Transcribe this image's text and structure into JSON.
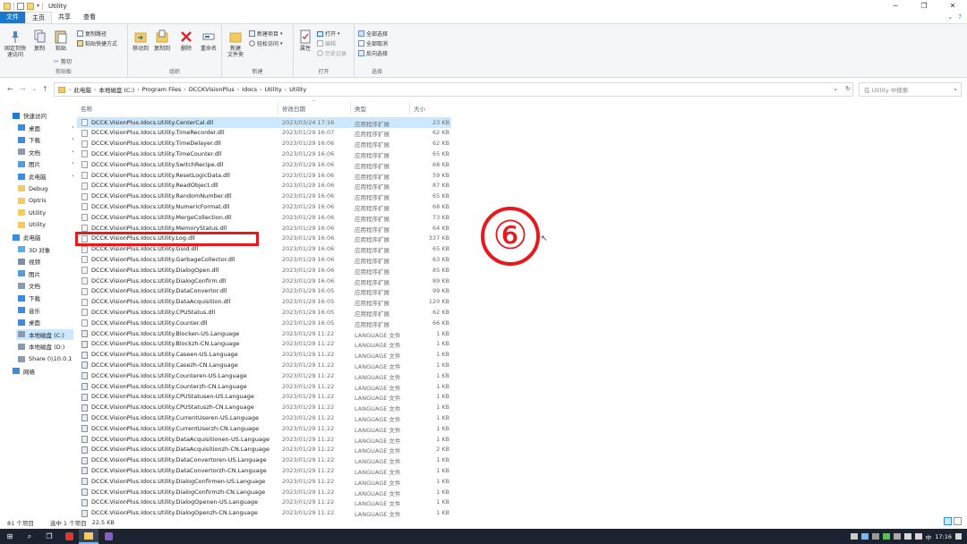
{
  "window": {
    "title": "Utility",
    "controls": [
      "─",
      "❐",
      "✕"
    ]
  },
  "tabs": {
    "file": "文件",
    "home": "主页",
    "share": "共享",
    "view": "查看"
  },
  "ribbon": {
    "clipboard": {
      "group_label": "剪贴板",
      "pin_quick": "固定到快速访问",
      "copy": "复制",
      "paste": "粘贴",
      "copy_path": "复制路径",
      "paste_shortcut": "粘贴快捷方式",
      "cut": "剪切"
    },
    "organize": {
      "group_label": "组织",
      "move_to": "移动到",
      "copy_to": "复制到",
      "delete": "删除",
      "rename": "重命名"
    },
    "new": {
      "group_label": "新建",
      "new_folder": "新建\n文件夹",
      "new_item": "新建项目",
      "easy_access": "轻松访问"
    },
    "open": {
      "group_label": "打开",
      "properties": "属性",
      "open": "打开",
      "edit": "编辑",
      "history": "历史记录"
    },
    "select": {
      "group_label": "选择",
      "select_all": "全部选择",
      "select_none": "全部取消",
      "invert": "反向选择"
    }
  },
  "address": {
    "crumbs": [
      "此电脑",
      "本地磁盘 (C:)",
      "Program Files",
      "DCCKVisionPlus",
      "Idocs",
      "Utility",
      "Utility"
    ],
    "search_placeholder": "在 Utility 中搜索"
  },
  "nav": [
    {
      "label": "快速访问",
      "icon": "star-icon",
      "color": "#1e7bd8",
      "indent": 0,
      "pin": false
    },
    {
      "label": "桌面",
      "icon": "desktop-icon",
      "color": "#3c8be0",
      "indent": 1,
      "pin": true
    },
    {
      "label": "下载",
      "icon": "download-icon",
      "color": "#3c8be0",
      "indent": 1,
      "pin": true
    },
    {
      "label": "文档",
      "icon": "documents-icon",
      "color": "#8a9bb0",
      "indent": 1,
      "pin": true
    },
    {
      "label": "图片",
      "icon": "pictures-icon",
      "color": "#5b9bd5",
      "indent": 1,
      "pin": true
    },
    {
      "label": "此电脑",
      "icon": "pc-icon",
      "color": "#3c8be0",
      "indent": 1,
      "pin": true
    },
    {
      "label": "Debug",
      "icon": "folder-icon",
      "color": "#f2cc63",
      "indent": 1,
      "pin": false
    },
    {
      "label": "Optris",
      "icon": "folder-icon",
      "color": "#f2cc63",
      "indent": 1,
      "pin": false
    },
    {
      "label": "Utility",
      "icon": "folder-icon",
      "color": "#f2cc63",
      "indent": 1,
      "pin": false
    },
    {
      "label": "Utility",
      "icon": "folder-icon",
      "color": "#f2cc63",
      "indent": 1,
      "pin": false
    },
    {
      "label": "此电脑",
      "icon": "pc-icon",
      "color": "#3c8be0",
      "indent": 0,
      "pin": false
    },
    {
      "label": "3D 对象",
      "icon": "3d-objects-icon",
      "color": "#5ab0e6",
      "indent": 1,
      "pin": false
    },
    {
      "label": "视频",
      "icon": "video-icon",
      "color": "#7d8fa5",
      "indent": 1,
      "pin": false
    },
    {
      "label": "图片",
      "icon": "pictures-icon",
      "color": "#5b9bd5",
      "indent": 1,
      "pin": false
    },
    {
      "label": "文档",
      "icon": "documents-icon",
      "color": "#8a9bb0",
      "indent": 1,
      "pin": false
    },
    {
      "label": "下载",
      "icon": "download-icon",
      "color": "#3c8be0",
      "indent": 1,
      "pin": false
    },
    {
      "label": "音乐",
      "icon": "music-icon",
      "color": "#3c8be0",
      "indent": 1,
      "pin": false
    },
    {
      "label": "桌面",
      "icon": "desktop-icon",
      "color": "#3c8be0",
      "indent": 1,
      "pin": false
    },
    {
      "label": "本地磁盘 (C:)",
      "icon": "drive-icon",
      "color": "#8a9bb0",
      "indent": 1,
      "pin": false,
      "selected": true
    },
    {
      "label": "本地磁盘 (D:)",
      "icon": "drive-icon",
      "color": "#8a9bb0",
      "indent": 1,
      "pin": false
    },
    {
      "label": "Share (\\\\10.0.1",
      "icon": "network-drive-icon",
      "color": "#8a9bb0",
      "indent": 1,
      "pin": false
    },
    {
      "label": "网络",
      "icon": "network-icon",
      "color": "#3c8be0",
      "indent": 0,
      "pin": false
    }
  ],
  "columns": {
    "name": "名称",
    "date": "修改日期",
    "type": "类型",
    "size": "大小"
  },
  "files": [
    {
      "name": "DCCK.VisionPlus.Idocs.Utility.CenterCal.dll",
      "date": "2023/03/24 17:16",
      "type": "应用程序扩展",
      "size": "23 KB",
      "selected": true
    },
    {
      "name": "DCCK.VisionPlus.Idocs.Utility.TimeRecorder.dll",
      "date": "2023/01/29 16:07",
      "type": "应用程序扩展",
      "size": "62 KB"
    },
    {
      "name": "DCCK.VisionPlus.Idocs.Utility.TimeDelayer.dll",
      "date": "2023/01/29 16:06",
      "type": "应用程序扩展",
      "size": "62 KB"
    },
    {
      "name": "DCCK.VisionPlus.Idocs.Utility.TimeCounter.dll",
      "date": "2023/01/29 16:06",
      "type": "应用程序扩展",
      "size": "65 KB"
    },
    {
      "name": "DCCK.VisionPlus.Idocs.Utility.SwitchRecipe.dll",
      "date": "2023/01/29 16:06",
      "type": "应用程序扩展",
      "size": "68 KB"
    },
    {
      "name": "DCCK.VisionPlus.Idocs.Utility.ResetLogicData.dll",
      "date": "2023/01/29 16:06",
      "type": "应用程序扩展",
      "size": "59 KB"
    },
    {
      "name": "DCCK.VisionPlus.Idocs.Utility.ReadObject.dll",
      "date": "2023/01/29 16:06",
      "type": "应用程序扩展",
      "size": "87 KB"
    },
    {
      "name": "DCCK.VisionPlus.Idocs.Utility.RandomNumber.dll",
      "date": "2023/01/29 16:06",
      "type": "应用程序扩展",
      "size": "65 KB"
    },
    {
      "name": "DCCK.VisionPlus.Idocs.Utility.NumericFormat.dll",
      "date": "2023/01/29 16:06",
      "type": "应用程序扩展",
      "size": "68 KB"
    },
    {
      "name": "DCCK.VisionPlus.Idocs.Utility.MergeCollection.dll",
      "date": "2023/01/29 16:06",
      "type": "应用程序扩展",
      "size": "73 KB"
    },
    {
      "name": "DCCK.VisionPlus.Idocs.Utility.MemoryStatus.dll",
      "date": "2023/01/29 16:06",
      "type": "应用程序扩展",
      "size": "64 KB"
    },
    {
      "name": "DCCK.VisionPlus.Idocs.Utility.Log.dll",
      "date": "2023/01/29 16:06",
      "type": "应用程序扩展",
      "size": "337 KB"
    },
    {
      "name": "DCCK.VisionPlus.Idocs.Utility.Guid.dll",
      "date": "2023/01/29 16:06",
      "type": "应用程序扩展",
      "size": "65 KB"
    },
    {
      "name": "DCCK.VisionPlus.Idocs.Utility.GarbageCollector.dll",
      "date": "2023/01/29 16:06",
      "type": "应用程序扩展",
      "size": "63 KB"
    },
    {
      "name": "DCCK.VisionPlus.Idocs.Utility.DialogOpen.dll",
      "date": "2023/01/29 16:06",
      "type": "应用程序扩展",
      "size": "85 KB"
    },
    {
      "name": "DCCK.VisionPlus.Idocs.Utility.DialogConfirm.dll",
      "date": "2023/01/29 16:06",
      "type": "应用程序扩展",
      "size": "89 KB"
    },
    {
      "name": "DCCK.VisionPlus.Idocs.Utility.DataConvertor.dll",
      "date": "2023/01/29 16:05",
      "type": "应用程序扩展",
      "size": "99 KB"
    },
    {
      "name": "DCCK.VisionPlus.Idocs.Utility.DataAcquisition.dll",
      "date": "2023/01/29 16:05",
      "type": "应用程序扩展",
      "size": "120 KB"
    },
    {
      "name": "DCCK.VisionPlus.Idocs.Utility.CPUStatus.dll",
      "date": "2023/01/29 16:05",
      "type": "应用程序扩展",
      "size": "62 KB"
    },
    {
      "name": "DCCK.VisionPlus.Idocs.Utility.Counter.dll",
      "date": "2023/01/29 16:05",
      "type": "应用程序扩展",
      "size": "66 KB"
    },
    {
      "name": "DCCK.VisionPlus.Idocs.Utility.Blocken-US.Language",
      "date": "2023/01/29 11:22",
      "type": "LANGUAGE 文件",
      "size": "1 KB"
    },
    {
      "name": "DCCK.VisionPlus.Idocs.Utility.Blockzh-CN.Language",
      "date": "2023/01/29 11:22",
      "type": "LANGUAGE 文件",
      "size": "1 KB"
    },
    {
      "name": "DCCK.VisionPlus.Idocs.Utility.Caseen-US.Language",
      "date": "2023/01/29 11:22",
      "type": "LANGUAGE 文件",
      "size": "1 KB"
    },
    {
      "name": "DCCK.VisionPlus.Idocs.Utility.Casezh-CN.Language",
      "date": "2023/01/29 11:22",
      "type": "LANGUAGE 文件",
      "size": "1 KB"
    },
    {
      "name": "DCCK.VisionPlus.Idocs.Utility.Counteren-US.Language",
      "date": "2023/01/29 11:22",
      "type": "LANGUAGE 文件",
      "size": "1 KB"
    },
    {
      "name": "DCCK.VisionPlus.Idocs.Utility.Counterzh-CN.Language",
      "date": "2023/01/29 11:22",
      "type": "LANGUAGE 文件",
      "size": "1 KB"
    },
    {
      "name": "DCCK.VisionPlus.Idocs.Utility.CPUStatusen-US.Language",
      "date": "2023/01/29 11:22",
      "type": "LANGUAGE 文件",
      "size": "1 KB"
    },
    {
      "name": "DCCK.VisionPlus.Idocs.Utility.CPUStatuszh-CN.Language",
      "date": "2023/01/29 11:22",
      "type": "LANGUAGE 文件",
      "size": "1 KB"
    },
    {
      "name": "DCCK.VisionPlus.Idocs.Utility.CurrentUseren-US.Language",
      "date": "2023/01/29 11:22",
      "type": "LANGUAGE 文件",
      "size": "1 KB"
    },
    {
      "name": "DCCK.VisionPlus.Idocs.Utility.CurrentUserzh-CN.Language",
      "date": "2023/01/29 11:22",
      "type": "LANGUAGE 文件",
      "size": "1 KB"
    },
    {
      "name": "DCCK.VisionPlus.Idocs.Utility.DataAcquisitionen-US.Language",
      "date": "2023/01/29 11:22",
      "type": "LANGUAGE 文件",
      "size": "1 KB"
    },
    {
      "name": "DCCK.VisionPlus.Idocs.Utility.DataAcquisitionzh-CN.Language",
      "date": "2023/01/29 11:22",
      "type": "LANGUAGE 文件",
      "size": "2 KB"
    },
    {
      "name": "DCCK.VisionPlus.Idocs.Utility.DataConvertoren-US.Language",
      "date": "2023/01/29 11:22",
      "type": "LANGUAGE 文件",
      "size": "1 KB"
    },
    {
      "name": "DCCK.VisionPlus.Idocs.Utility.DataConvertorzh-CN.Language",
      "date": "2023/01/29 11:22",
      "type": "LANGUAGE 文件",
      "size": "1 KB"
    },
    {
      "name": "DCCK.VisionPlus.Idocs.Utility.DialogConfirmen-US.Language",
      "date": "2023/01/29 11:22",
      "type": "LANGUAGE 文件",
      "size": "1 KB"
    },
    {
      "name": "DCCK.VisionPlus.Idocs.Utility.DialogConfirmzh-CN.Language",
      "date": "2023/01/29 11:22",
      "type": "LANGUAGE 文件",
      "size": "1 KB"
    },
    {
      "name": "DCCK.VisionPlus.Idocs.Utility.DialogOpenen-US.Language",
      "date": "2023/01/29 11:22",
      "type": "LANGUAGE 文件",
      "size": "1 KB"
    },
    {
      "name": "DCCK.VisionPlus.Idocs.Utility.DialogOpenzh-CN.Language",
      "date": "2023/01/29 11:22",
      "type": "LANGUAGE 文件",
      "size": "1 KB"
    }
  ],
  "annotation": {
    "circled_number": "⑥",
    "color": "#e8181c"
  },
  "status": {
    "count": "81 个项目",
    "selected": "选中 1 个项目",
    "size": "22.5 KB"
  },
  "taskbar": {
    "time": "17:16",
    "lang": "中",
    "apps": [
      "start-icon",
      "search-icon",
      "task-view-icon",
      "wps-icon",
      "file-explorer-icon",
      "visual-studio-icon"
    ]
  }
}
